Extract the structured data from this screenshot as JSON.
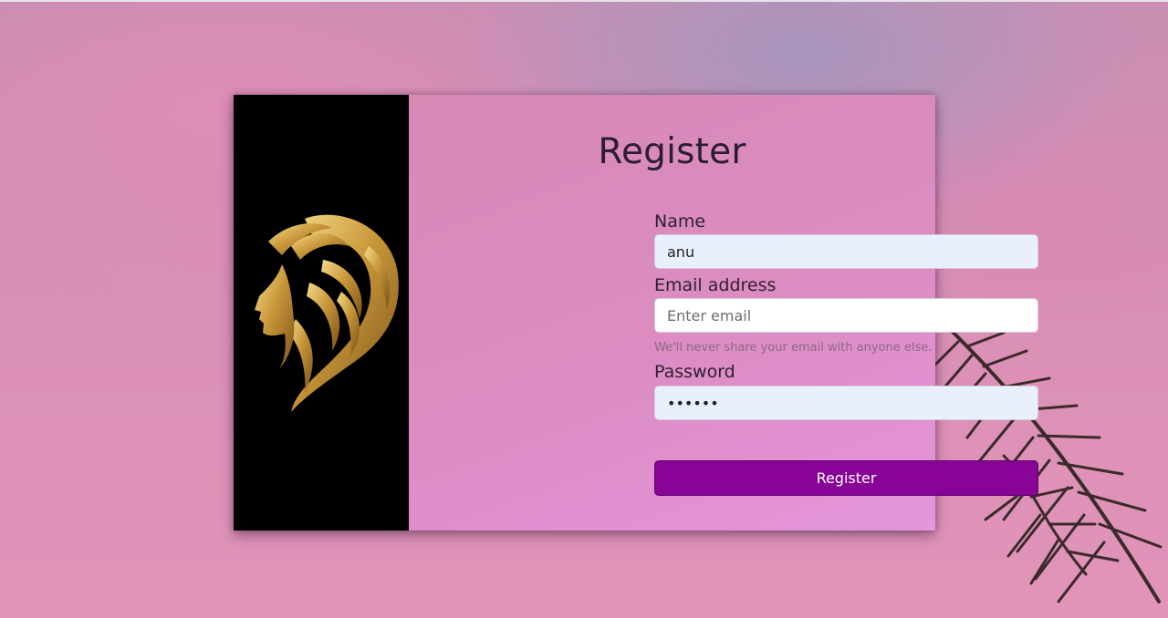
{
  "form": {
    "title": "Register",
    "name_label": "Name",
    "name_value": "anu",
    "email_label": "Email address",
    "email_placeholder": "Enter email",
    "email_help": "We'll never share your email with anyone else.",
    "password_label": "Password",
    "password_value": "••••••",
    "submit_label": "Register"
  },
  "colors": {
    "accent": "#870496",
    "side_panel": "#000000",
    "logo_gold": "#d4a94a"
  },
  "icons": {
    "logo": "woman-hair-silhouette-logo",
    "background_plant": "palm-frond"
  }
}
